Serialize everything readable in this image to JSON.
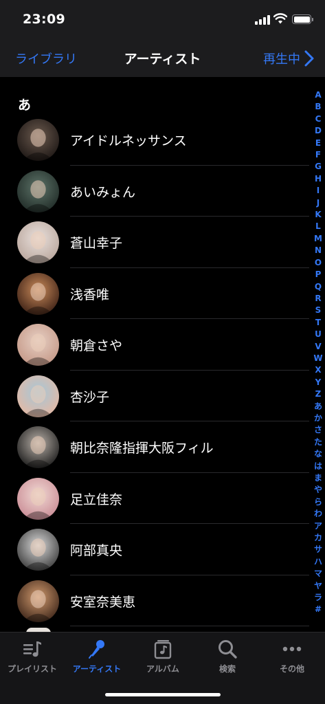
{
  "status_bar": {
    "time": "23:09"
  },
  "nav": {
    "back_label": "ライブラリ",
    "title": "アーティスト",
    "now_playing_label": "再生中"
  },
  "section": {
    "header": "あ"
  },
  "artists": [
    {
      "name": "アイドルネッサンス",
      "avatar_colors": [
        "#6b5a4e",
        "#1c1614"
      ]
    },
    {
      "name": "あいみょん",
      "avatar_colors": [
        "#5d7368",
        "#1f2a26"
      ]
    },
    {
      "name": "蒼山幸子",
      "avatar_colors": [
        "#e9e0dc",
        "#b8a59b"
      ]
    },
    {
      "name": "浅香唯",
      "avatar_colors": [
        "#c98a5a",
        "#3a1f14"
      ]
    },
    {
      "name": "朝倉さや",
      "avatar_colors": [
        "#e6cfc3",
        "#c49786"
      ]
    },
    {
      "name": "杏沙子",
      "avatar_colors": [
        "#a5c7d8",
        "#e7b8a2"
      ]
    },
    {
      "name": "朝比奈隆指揮大阪フィル",
      "avatar_colors": [
        "#b8b0a8",
        "#1a1a1a"
      ]
    },
    {
      "name": "足立佳奈",
      "avatar_colors": [
        "#f0d9d3",
        "#c98a94"
      ]
    },
    {
      "name": "阿部真央",
      "avatar_colors": [
        "#d9d9d9",
        "#3a3a3a"
      ]
    },
    {
      "name": "安室奈美恵",
      "avatar_colors": [
        "#d19a6e",
        "#3b2418"
      ]
    }
  ],
  "index_letters": [
    "A",
    "B",
    "C",
    "D",
    "E",
    "F",
    "G",
    "H",
    "I",
    "J",
    "K",
    "L",
    "M",
    "N",
    "O",
    "P",
    "Q",
    "R",
    "S",
    "T",
    "U",
    "V",
    "W",
    "X",
    "Y",
    "Z",
    "あ",
    "か",
    "さ",
    "た",
    "な",
    "は",
    "ま",
    "や",
    "ら",
    "わ",
    "ア",
    "カ",
    "サ",
    "ハ",
    "マ",
    "ヤ",
    "ラ",
    "#"
  ],
  "tabs": [
    {
      "label": "プレイリスト",
      "icon": "playlist-icon",
      "active": false
    },
    {
      "label": "アーティスト",
      "icon": "microphone-icon",
      "active": true
    },
    {
      "label": "アルバム",
      "icon": "album-icon",
      "active": false
    },
    {
      "label": "検索",
      "icon": "search-icon",
      "active": false
    },
    {
      "label": "その他",
      "icon": "more-icon",
      "active": false
    }
  ],
  "colors": {
    "accent": "#3478f6",
    "background": "#000000",
    "bar": "#1c1c1e"
  }
}
